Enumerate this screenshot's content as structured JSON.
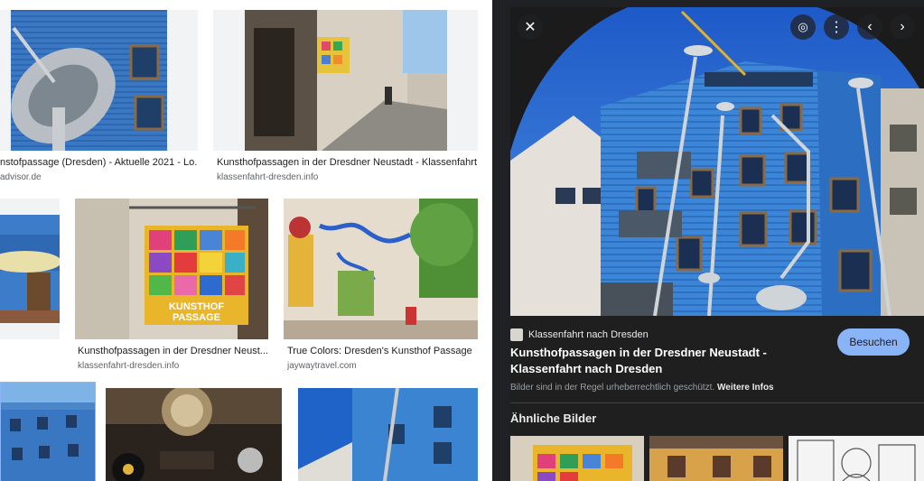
{
  "results": [
    {
      "title": "nstofpassage (Dresden) - Aktuelle 2021 - Lo...",
      "source": "advisor.de"
    },
    {
      "title": "Kunsthofpassagen in der Dresdner Neustadt - Klassenfahrt ...",
      "source": "klassenfahrt-dresden.info"
    },
    {
      "title": "Kunsthofpassagen in der Dresdner Neust...",
      "source": "klassenfahrt-dresden.info"
    },
    {
      "title": "True Colors: Dresden's Kunsthof Passage",
      "source": "jaywaytravel.com"
    }
  ],
  "sign_text": "KUNSTHOF PASSAGE",
  "panel": {
    "site_name": "Klassenfahrt nach Dresden",
    "title": "Kunsthofpassagen in der Dresdner Neustadt - Klassenfahrt nach Dresden",
    "visit_label": "Besuchen",
    "copyright_text": "Bilder sind in der Regel urheberrechtlich geschützt.",
    "more_info": "Weitere Infos",
    "similar_heading": "Ähnliche Bilder",
    "icons": [
      "close-icon",
      "lens-icon",
      "more-vert-icon",
      "chevron-left-icon",
      "chevron-right-icon"
    ]
  }
}
